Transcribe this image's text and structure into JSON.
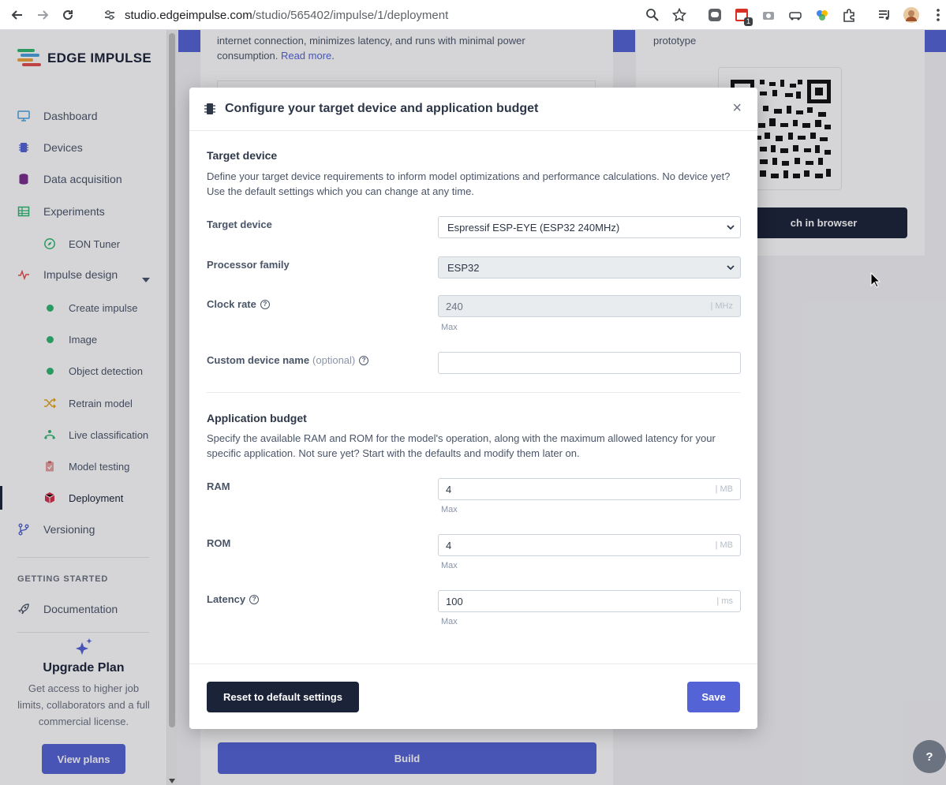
{
  "browser": {
    "url_host": "studio.edgeimpulse.com",
    "url_path": "/studio/565402/impulse/1/deployment",
    "extension_badge": "1"
  },
  "colors": {
    "brand_dark": "#1a2338",
    "brand_accent": "#5463d6",
    "success_green": "#2fb76f"
  },
  "sidebar": {
    "logo_text": "EDGE IMPULSE",
    "items": [
      {
        "label": "Dashboard",
        "icon": "monitor-icon"
      },
      {
        "label": "Devices",
        "icon": "chip-icon"
      },
      {
        "label": "Data acquisition",
        "icon": "database-icon"
      },
      {
        "label": "Experiments",
        "icon": "table-icon"
      },
      {
        "label": "EON Tuner",
        "icon": "compass-icon"
      },
      {
        "label": "Impulse design",
        "icon": "pulse-icon"
      },
      {
        "label": "Create impulse",
        "icon": "green-dot-icon"
      },
      {
        "label": "Image",
        "icon": "green-dot-icon"
      },
      {
        "label": "Object detection",
        "icon": "green-dot-icon"
      },
      {
        "label": "Retrain model",
        "icon": "shuffle-icon"
      },
      {
        "label": "Live classification",
        "icon": "live-icon"
      },
      {
        "label": "Model testing",
        "icon": "clipboard-check-icon"
      },
      {
        "label": "Deployment",
        "icon": "cube-icon"
      },
      {
        "label": "Versioning",
        "icon": "branch-icon"
      }
    ],
    "getting_started_title": "GETTING STARTED",
    "documentation_label": "Documentation",
    "upgrade": {
      "title": "Upgrade Plan",
      "text": "Get access to higher job limits, collaborators and a full commercial license.",
      "button": "View plans"
    }
  },
  "background": {
    "left_text": "internet connection, minimizes latency, and runs with minimal power consumption.",
    "read_more": "Read more",
    "right_text": "prototype",
    "launch_button": "ch in browser",
    "build_button": "Build"
  },
  "modal": {
    "title": "Configure your target device and application budget",
    "close": "×",
    "target_section": {
      "heading": "Target device",
      "description": "Define your target device requirements to inform model optimizations and performance calculations. No device yet? Use the default settings which you can change at any time.",
      "target_device_label": "Target device",
      "target_device_value": "Espressif ESP-EYE (ESP32 240MHz)",
      "processor_family_label": "Processor family",
      "processor_family_value": "ESP32",
      "clock_rate_label": "Clock rate",
      "clock_rate_value": "240",
      "clock_rate_unit": "| MHz",
      "clock_rate_hint": "Max",
      "custom_name_label": "Custom device name",
      "custom_name_optional": "(optional)",
      "custom_name_value": ""
    },
    "budget_section": {
      "heading": "Application budget",
      "description": "Specify the available RAM and ROM for the model's operation, along with the maximum allowed latency for your specific application. Not sure yet? Start with the defaults and modify them later on.",
      "ram_label": "RAM",
      "ram_value": "4",
      "ram_unit": "| MB",
      "ram_hint": "Max",
      "rom_label": "ROM",
      "rom_value": "4",
      "rom_unit": "| MB",
      "rom_hint": "Max",
      "latency_label": "Latency",
      "latency_value": "100",
      "latency_unit": "| ms",
      "latency_hint": "Max"
    },
    "footer": {
      "reset_button": "Reset to default settings",
      "save_button": "Save"
    }
  },
  "help_button": "?"
}
